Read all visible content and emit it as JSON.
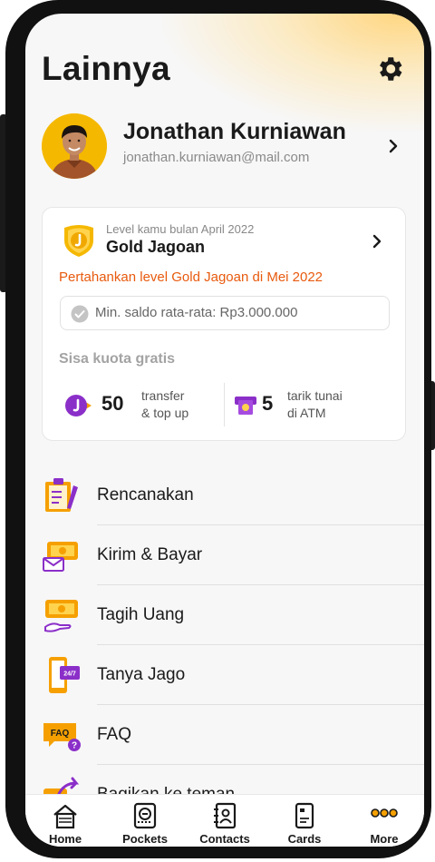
{
  "header": {
    "title": "Lainnya"
  },
  "profile": {
    "name": "Jonathan Kurniawan",
    "email": "jonathan.kurniawan@mail.com"
  },
  "level_card": {
    "caption": "Level kamu bulan April 2022",
    "level_name": "Gold Jagoan",
    "maintain_text": "Pertahankan level Gold Jagoan di Mei 2022",
    "requirement": "Min. saldo rata-rata: Rp3.000.000",
    "quota_title": "Sisa kuota gratis",
    "quota": [
      {
        "count": "50",
        "label_line1": "transfer",
        "label_line2": "& top up"
      },
      {
        "count": "5",
        "label_line1": "tarik tunai",
        "label_line2": "di ATM"
      }
    ]
  },
  "menu": [
    {
      "label": "Rencanakan",
      "icon": "planner-icon"
    },
    {
      "label": "Kirim & Bayar",
      "icon": "send-money-icon"
    },
    {
      "label": "Tagih Uang",
      "icon": "request-money-icon"
    },
    {
      "label": "Tanya Jago",
      "icon": "help-24-7-icon"
    },
    {
      "label": "FAQ",
      "icon": "faq-icon"
    },
    {
      "label": "Bagikan ke teman",
      "icon": "share-icon"
    }
  ],
  "tabbar": [
    {
      "label": "Home",
      "icon": "home-icon"
    },
    {
      "label": "Pockets",
      "icon": "pockets-icon"
    },
    {
      "label": "Contacts",
      "icon": "contacts-icon"
    },
    {
      "label": "Cards",
      "icon": "cards-icon"
    },
    {
      "label": "More",
      "icon": "more-icon",
      "active": true
    }
  ],
  "colors": {
    "accent_orange": "#e85a0e",
    "brand_yellow": "#f5b800",
    "brand_purple": "#8b2fc9"
  }
}
